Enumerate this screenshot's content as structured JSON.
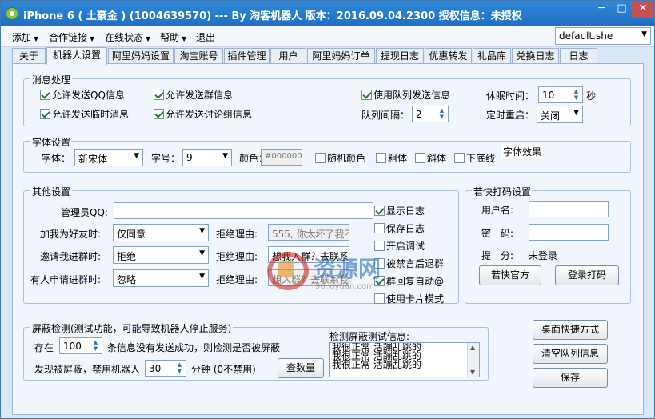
{
  "titlebar": {
    "title": "iPhone 6 ( 土豪金 ) (1004639570)  --- By 淘客机器人 版本：2016.09.04.2300 授权信息：未授权",
    "minimize": "─",
    "maximize": "□",
    "close": "✕"
  },
  "menubar": {
    "items": [
      "添加",
      "合作链接",
      "在线状态",
      "帮助",
      "退出"
    ],
    "profile_select": "default.she"
  },
  "tabs": [
    "关于",
    "机器人设置",
    "阿里妈妈设置",
    "淘宝账号",
    "插件管理",
    "用户",
    "阿里妈妈订单",
    "提现日志",
    "优惠转发",
    "礼品库",
    "兑换日志",
    "日志"
  ],
  "active_tab": "机器人设置",
  "msg": {
    "title": "消息处理",
    "allow_qq": "允许发送QQ信息",
    "allow_group": "允许发送群信息",
    "use_queue": "使用队列发送信息",
    "allow_temp": "允许发送临时消息",
    "allow_discuss": "允许发送讨论组信息",
    "sleep_label": "休眠时间：",
    "sleep_value": "10",
    "sleep_unit": "秒",
    "queue_label": "队列间隔：",
    "queue_value": "2",
    "restart_label": "定时重启：",
    "restart_value": "关闭"
  },
  "font": {
    "title": "字体设置",
    "font_label": "字体：",
    "font_value": "新宋体",
    "size_label": "字号：",
    "size_value": "9",
    "color_label": "颜色：",
    "color_value": "#000000",
    "random": "随机颜色",
    "bold": "粗体",
    "italic": "斜体",
    "underline": "下底线",
    "effect": "字体效果"
  },
  "other": {
    "title": "其他设置",
    "admin_label": "管理员QQ:",
    "admin_value": "",
    "friend_label": "加我为好友时:",
    "friend_value": "仅同意",
    "invite_label": "邀请我进群时:",
    "invite_value": "拒绝",
    "apply_label": "有人申请进群时:",
    "apply_value": "忽略",
    "reason_label": "拒绝理由:",
    "reason1": "555, 你太坏了我不",
    "reason2": "想我入群？去联系",
    "reason3": "想入群？去联系我",
    "show_log": "显示日志",
    "save_log": "保存日志",
    "debug": "开启调试",
    "ban_exit": "被禁言后退群",
    "auto_reply": "群回复自动@",
    "card_mode": "使用卡片模式"
  },
  "captcha": {
    "title": "若快打码设置",
    "user_label": "用户名:",
    "pass_label": "密　码:",
    "score_label": "提　分:",
    "score_value": "未登录",
    "site_btn": "若快官方",
    "login_btn": "登录打码"
  },
  "shield": {
    "title": "屏蔽检测(测试功能，可能导致机器人停止服务)",
    "exist_label": "存在",
    "exist_value": "100",
    "exist_tail": "条信息没有发送成功，则检测是否被屏蔽",
    "found_label": "发现被屏蔽，禁用机器人",
    "found_value": "30",
    "found_tail": "分钟 (0不禁用)",
    "check_btn": "查数量",
    "info_title": "检测屏蔽测试信息:",
    "info_lines": [
      "我很正常 活蹦乱跳的",
      "我很正常 活蹦乱跳的",
      "我很正常 活蹦乱跳的"
    ]
  },
  "right_buttons": {
    "shortcut": "桌面快捷方式",
    "clear_queue": "清空队列信息",
    "save": "保存"
  },
  "watermark": {
    "text": "资源网",
    "sub": "90.xiyuan.com"
  },
  "checks": {
    "allow_qq": true,
    "allow_group": true,
    "use_queue": true,
    "allow_temp": true,
    "allow_discuss": true,
    "random": false,
    "bold": false,
    "italic": false,
    "underline": false,
    "show_log": true,
    "save_log": false,
    "debug": false,
    "ban_exit": false,
    "auto_reply": true,
    "card_mode": false
  },
  "colors": {
    "titlebar": "#1f6fc4",
    "window_bg": "#d9e7f6",
    "panel_bg": "#f1f6fc",
    "close": "#c75050"
  }
}
